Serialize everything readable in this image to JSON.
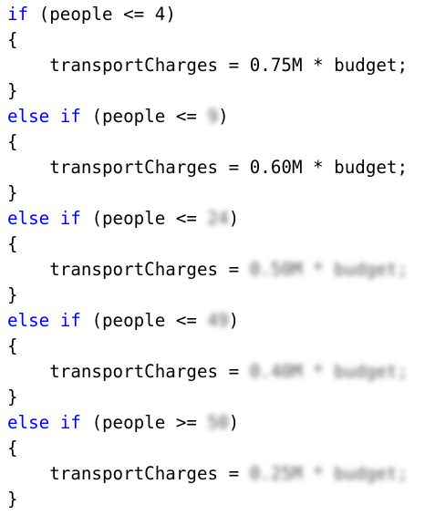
{
  "colors": {
    "keyword": "#0000ff",
    "text": "#000000"
  },
  "code": {
    "blocks": [
      {
        "keyword": "if",
        "open_paren": "(",
        "variable": "people",
        "operator": "<=",
        "value": "4",
        "value_blurred": false,
        "close_paren": ")",
        "open_brace": "{",
        "target": "transportCharges",
        "assign": "=",
        "expression": "0.75M * budget;",
        "expression_blurred": false,
        "close_brace": "}"
      },
      {
        "keyword": "else if",
        "open_paren": "(",
        "variable": "people",
        "operator": "<=",
        "value": "9",
        "value_blurred": true,
        "close_paren": ")",
        "open_brace": "{",
        "target": "transportCharges",
        "assign": "=",
        "expression": "0.60M * budget;",
        "expression_blurred": false,
        "close_brace": "}"
      },
      {
        "keyword": "else if",
        "open_paren": "(",
        "variable": "people",
        "operator": "<=",
        "value": "24",
        "value_blurred": true,
        "close_paren": ")",
        "open_brace": "{",
        "target": "transportCharges",
        "assign": "=",
        "expression": "0.50M * budget;",
        "expression_blurred": true,
        "close_brace": "}"
      },
      {
        "keyword": "else if",
        "open_paren": "(",
        "variable": "people",
        "operator": "<=",
        "value": "49",
        "value_blurred": true,
        "close_paren": ")",
        "open_brace": "{",
        "target": "transportCharges",
        "assign": "=",
        "expression": "0.40M * budget;",
        "expression_blurred": true,
        "close_brace": "}"
      },
      {
        "keyword": "else if",
        "open_paren": "(",
        "variable": "people",
        "operator": ">=",
        "value": "50",
        "value_blurred": true,
        "close_paren": ")",
        "open_brace": "{",
        "target": "transportCharges",
        "assign": "=",
        "expression": "0.25M * budget;",
        "expression_blurred": true,
        "close_brace": "}"
      }
    ]
  }
}
